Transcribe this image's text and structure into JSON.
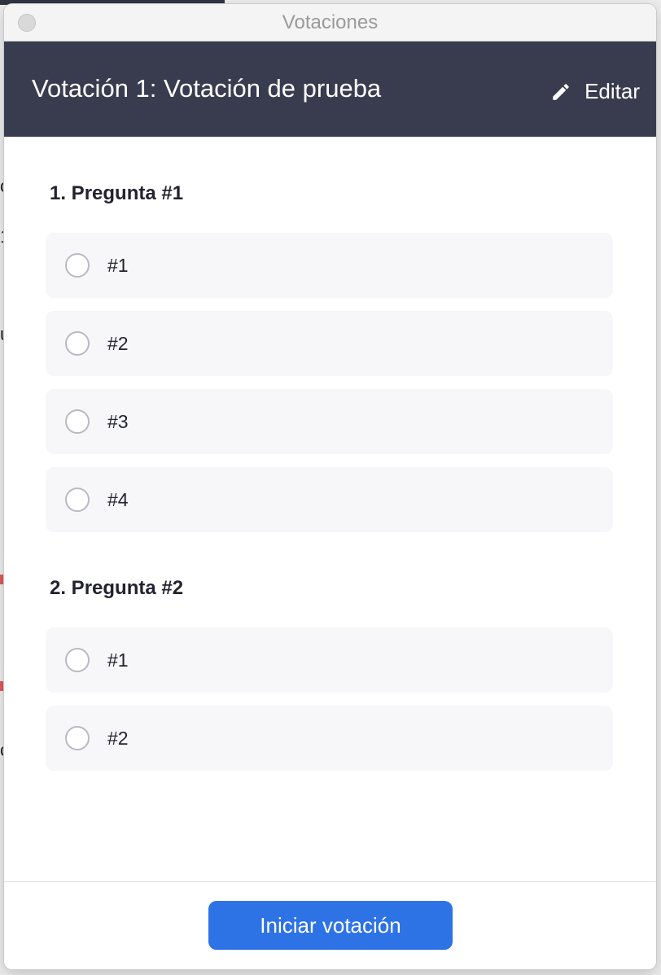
{
  "window": {
    "title": "Votaciones"
  },
  "header": {
    "title": "Votación 1: Votación de prueba",
    "edit_label": "Editar",
    "edit_icon": "pencil-icon"
  },
  "questions": [
    {
      "title": "1. Pregunta #1",
      "options": [
        {
          "label": "#1"
        },
        {
          "label": "#2"
        },
        {
          "label": "#3"
        },
        {
          "label": "#4"
        }
      ]
    },
    {
      "title": "2. Pregunta #2",
      "options": [
        {
          "label": "#1"
        },
        {
          "label": "#2"
        }
      ]
    }
  ],
  "footer": {
    "start_label": "Iniciar votación"
  },
  "background_fragments": [
    "o",
    "1",
    "u",
    "c"
  ],
  "colors": {
    "header_bg": "#393c4e",
    "accent": "#2d73e6",
    "option_bg": "#f7f7fa"
  }
}
